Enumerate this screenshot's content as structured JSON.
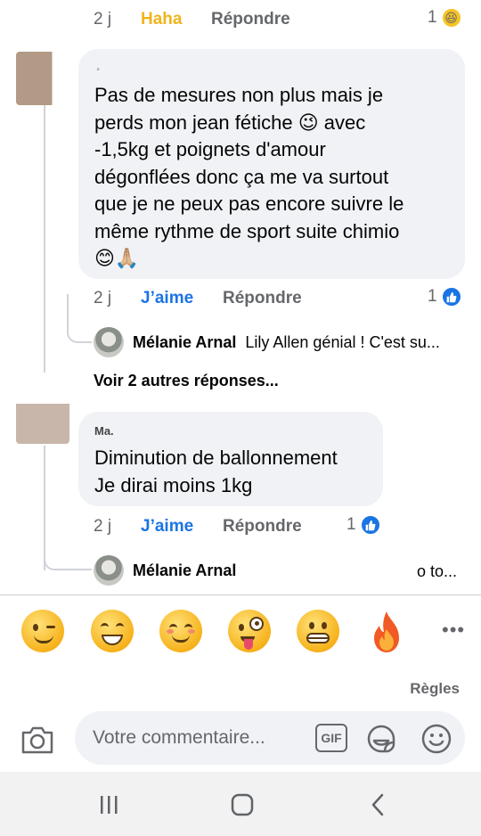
{
  "comments": [
    {
      "time": "2 j",
      "reaction_label": "Haha",
      "reply_label": "Répondre",
      "reaction_count": "1",
      "reaction_icon": "haha-icon"
    },
    {
      "author": "¸",
      "text": "Pas de mesures non plus mais je\nperds mon jean fétiche 😉 avec\n-1,5kg et poignets d'amour\ndégonflées donc ça me va surtout\nque je ne peux pas encore suivre le\nmême rythme de sport suite chimio\n😊🙏🏼",
      "time": "2 j",
      "like_label": "J’aime",
      "reply_label": "Répondre",
      "reaction_count": "1",
      "reaction_icon": "like-icon",
      "reply_preview": {
        "name": "Mélanie Arnal",
        "snippet": "Lily Allen génial ! C'est su..."
      },
      "more_replies": "Voir 2 autres réponses..."
    },
    {
      "author": "Ma.",
      "text": "Diminution de ballonnement\nJe dirai moins 1kg",
      "time": "2 j",
      "like_label": "J’aime",
      "reply_label": "Répondre",
      "reaction_count": "1",
      "reaction_icon": "like-icon",
      "reply_preview": {
        "name": "Mélanie Arnal",
        "snippet": "o to..."
      }
    }
  ],
  "emoji_bar": {
    "items": [
      "wink-emoji",
      "grin-emoji",
      "smile-emoji",
      "zany-emoji",
      "grimace-emoji",
      "fire-emoji"
    ],
    "more": "•••"
  },
  "rules_label": "Règles",
  "composer": {
    "placeholder": "Votre commentaire...",
    "gif_label": "GIF"
  },
  "colors": {
    "accent": "#1b74e4",
    "haha": "#f0b31b",
    "bubble": "#f0f2f5",
    "secondary_text": "#65676b"
  }
}
